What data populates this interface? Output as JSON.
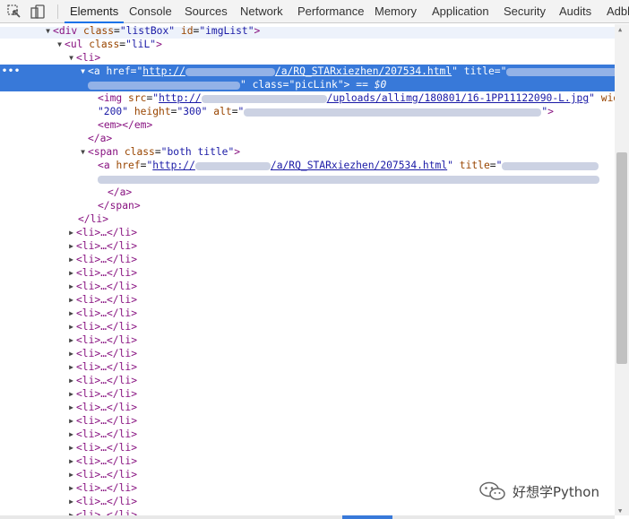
{
  "devtools": {
    "tabs": [
      "Elements",
      "Console",
      "Sources",
      "Network",
      "Performance",
      "Memory",
      "Application",
      "Security",
      "Audits",
      "Adbl"
    ],
    "active_tab": "Elements"
  },
  "dom": {
    "div_tag": "div",
    "div_class_attr": "class",
    "div_class": "\"listBox\"",
    "div_id_attr": "id",
    "div_id": "\"imgList\"",
    "ul_tag": "ul",
    "ul_class_attr": "class",
    "ul_class": "\"liL\"",
    "li_tag": "li",
    "a_tag": "a",
    "href_attr": "href",
    "href_prefix": "http://",
    "href_path": "/a/RQ_STARxiezhen/207534.html",
    "title_attr": "title",
    "pic_class_attr": "class",
    "pic_class": "\"picLink\"",
    "sel_marker": "== $0",
    "img_tag": "img",
    "src_attr": "src",
    "img_src_prefix": "http://",
    "img_src_path": "/uploads/allimg/180801/16-1PP11122090-L.jpg",
    "width_attr": "width",
    "width_val": "\"200\"",
    "height_attr": "height",
    "height_val": "\"300\"",
    "alt_attr": "alt",
    "em_tag": "em",
    "span_tag": "span",
    "span_class_attr": "class",
    "span_class": "\"both title\"",
    "collapsed_li": "<li>…</li>"
  },
  "watermark": {
    "text": "好想学Python"
  },
  "colors": {
    "tag": "#881280",
    "attr": "#994500",
    "value": "#1a1aa6",
    "selection": "#3879d9",
    "tab_underline": "#1a73e8"
  }
}
